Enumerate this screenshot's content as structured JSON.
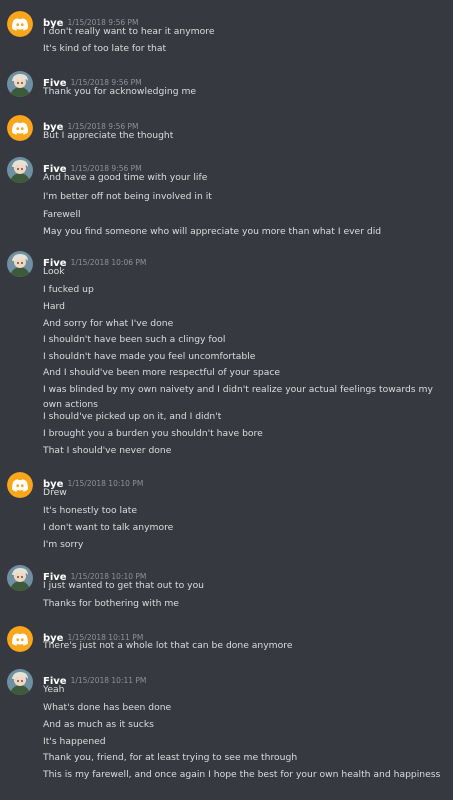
{
  "groups": [
    {
      "author": "bye",
      "avatar": "discord-logo-icon",
      "timestamp": "1/15/2018 9:56 PM",
      "messages": [
        "I don't really want to hear it anymore",
        "It's kind of too late for that"
      ]
    },
    {
      "author": "Five",
      "avatar": "anime-character-avatar",
      "timestamp": "1/15/2018 9:56 PM",
      "messages": [
        "Thank you for acknowledging me"
      ]
    },
    {
      "author": "bye",
      "avatar": "discord-logo-icon",
      "timestamp": "1/15/2018 9:56 PM",
      "messages": [
        "But I appreciate the thought"
      ]
    },
    {
      "author": "Five",
      "avatar": "anime-character-avatar",
      "timestamp": "1/15/2018 9:56 PM",
      "messages": [
        "And have a good time with your life",
        "I'm better off not being involved in it",
        "Farewell",
        "May you find someone who will appreciate you more than what I ever did"
      ]
    },
    {
      "author": "Five",
      "avatar": "anime-character-avatar",
      "timestamp": "1/15/2018 10:06 PM",
      "messages": [
        "Look",
        "I fucked up",
        "Hard",
        "And sorry for what I've done",
        "I shouldn't have been such a clingy fool",
        "I shouldn't have made you feel uncomfortable",
        "And I should've been more respectful of your space",
        "I was blinded by my own naivety and I didn't realize your actual feelings towards my own actions",
        "I should've picked up on it, and I didn't",
        "I brought you a burden you shouldn't have bore",
        "That I should've never done"
      ]
    },
    {
      "author": "bye",
      "avatar": "discord-logo-icon",
      "timestamp": "1/15/2018 10:10 PM",
      "messages": [
        "Drew",
        "It's honestly too late",
        "I don't want to talk anymore",
        "I'm sorry"
      ]
    },
    {
      "author": "Five",
      "avatar": "anime-character-avatar",
      "timestamp": "1/15/2018 10:10 PM",
      "messages": [
        "I just wanted to get that out to you",
        "Thanks for bothering with me"
      ]
    },
    {
      "author": "bye",
      "avatar": "discord-logo-icon",
      "timestamp": "1/15/2018 10:11 PM",
      "messages": [
        "There's just not a whole lot that can be done anymore"
      ]
    },
    {
      "author": "Five",
      "avatar": "anime-character-avatar",
      "timestamp": "1/15/2018 10:11 PM",
      "messages": [
        "Yeah",
        "What's done has been done",
        "And as much as it sucks",
        "It's happened",
        "Thank you, friend, for at least trying to see me through",
        "This is my farewell, and once again I hope the best for your own health and happiness"
      ]
    }
  ],
  "colors": {
    "background": "#36393f",
    "username": "#ffffff",
    "timestamp": "#8e9297",
    "message_text": "#dcddde",
    "discord_avatar_bg": "#faa61a"
  }
}
